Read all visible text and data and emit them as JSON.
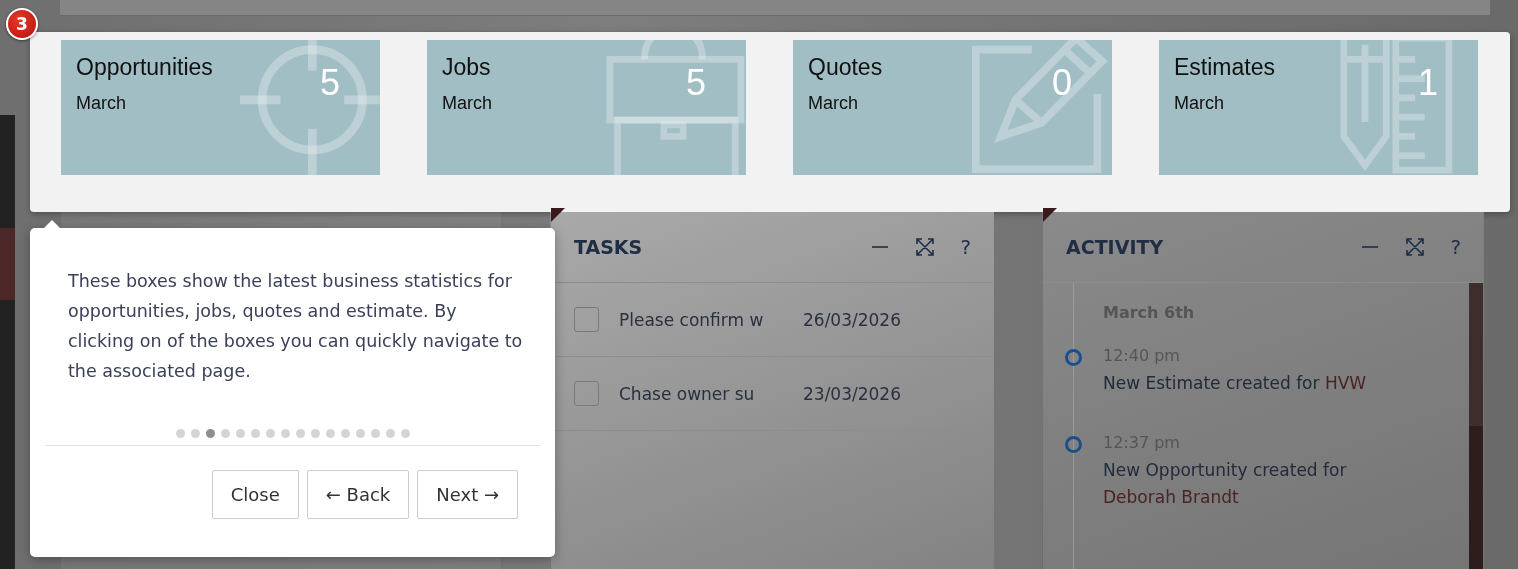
{
  "highlight": {
    "step_badge": "3",
    "cards": [
      {
        "title": "Opportunities",
        "period": "March",
        "count": "5"
      },
      {
        "title": "Jobs",
        "period": "March",
        "count": "5"
      },
      {
        "title": "Quotes",
        "period": "March",
        "count": "0"
      },
      {
        "title": "Estimates",
        "period": "March",
        "count": "1"
      }
    ]
  },
  "tour": {
    "text": "These boxes show the latest business statistics for opportunities, jobs, quotes and estimate. By clicking on of the boxes you can quickly navigate to the associated page.",
    "steps": [
      {
        "selected": false
      },
      {
        "selected": false
      },
      {
        "selected": true
      },
      {
        "selected": false
      },
      {
        "selected": false
      },
      {
        "selected": false
      },
      {
        "selected": false
      },
      {
        "selected": false
      },
      {
        "selected": false
      },
      {
        "selected": false
      },
      {
        "selected": false
      },
      {
        "selected": false
      },
      {
        "selected": false
      },
      {
        "selected": false
      },
      {
        "selected": false
      },
      {
        "selected": false
      }
    ],
    "buttons": [
      {
        "label": "Close"
      },
      {
        "label": "← Back"
      },
      {
        "label": "Next →"
      }
    ]
  },
  "tasks": {
    "title": "TASKS",
    "help": "?",
    "rows": [
      {
        "title": "Please confirm w",
        "due": "26/03/2026",
        "checked": false
      },
      {
        "title": "Chase owner su",
        "due": "23/03/2026",
        "checked": false
      }
    ]
  },
  "activity": {
    "title": "ACTIVITY",
    "help": "?",
    "groups": [
      {
        "date": "March 6th",
        "entries": [
          {
            "time": "12:40 pm",
            "text": "New Estimate created for",
            "link": "HVW"
          },
          {
            "time": "12:37 pm",
            "text": "New Opportunity created for",
            "link": "Deborah Brandt"
          }
        ]
      }
    ]
  }
}
